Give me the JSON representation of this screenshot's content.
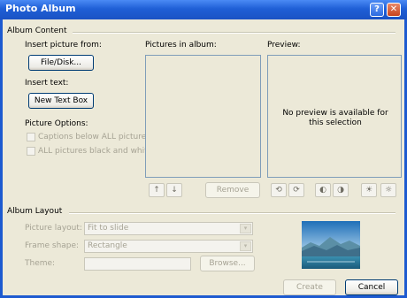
{
  "window": {
    "title": "Photo Album",
    "help_glyph": "?",
    "close_glyph": "✕"
  },
  "album_content": {
    "group_label": "Album Content",
    "insert_picture_label": "Insert picture from:",
    "file_disk_button": "File/Disk...",
    "insert_text_label": "Insert text:",
    "new_text_box_button": "New Text Box",
    "picture_options_label": "Picture Options:",
    "captions_checkbox": "Captions below ALL pictures",
    "bw_checkbox": "ALL pictures black and white",
    "pictures_in_album_label": "Pictures in album:",
    "preview_label": "Preview:",
    "preview_message": "No preview is available for this selection",
    "move_up_glyph": "↑",
    "move_down_glyph": "↓",
    "remove_button": "Remove",
    "icon_glyphs": [
      "⟲",
      "⟳",
      "◐",
      "◑",
      "☀",
      "☼"
    ]
  },
  "album_layout": {
    "group_label": "Album Layout",
    "picture_layout_label": "Picture layout:",
    "picture_layout_value": "Fit to slide",
    "frame_shape_label": "Frame shape:",
    "frame_shape_value": "Rectangle",
    "theme_label": "Theme:",
    "theme_value": "",
    "browse_button": "Browse...",
    "combo_arrow": "▾"
  },
  "footer": {
    "create_button": "Create",
    "cancel_button": "Cancel"
  },
  "colors": {
    "titlebar": "#1f5fd6",
    "dialog_bg": "#ece9d8",
    "border": "#7f9db9"
  }
}
